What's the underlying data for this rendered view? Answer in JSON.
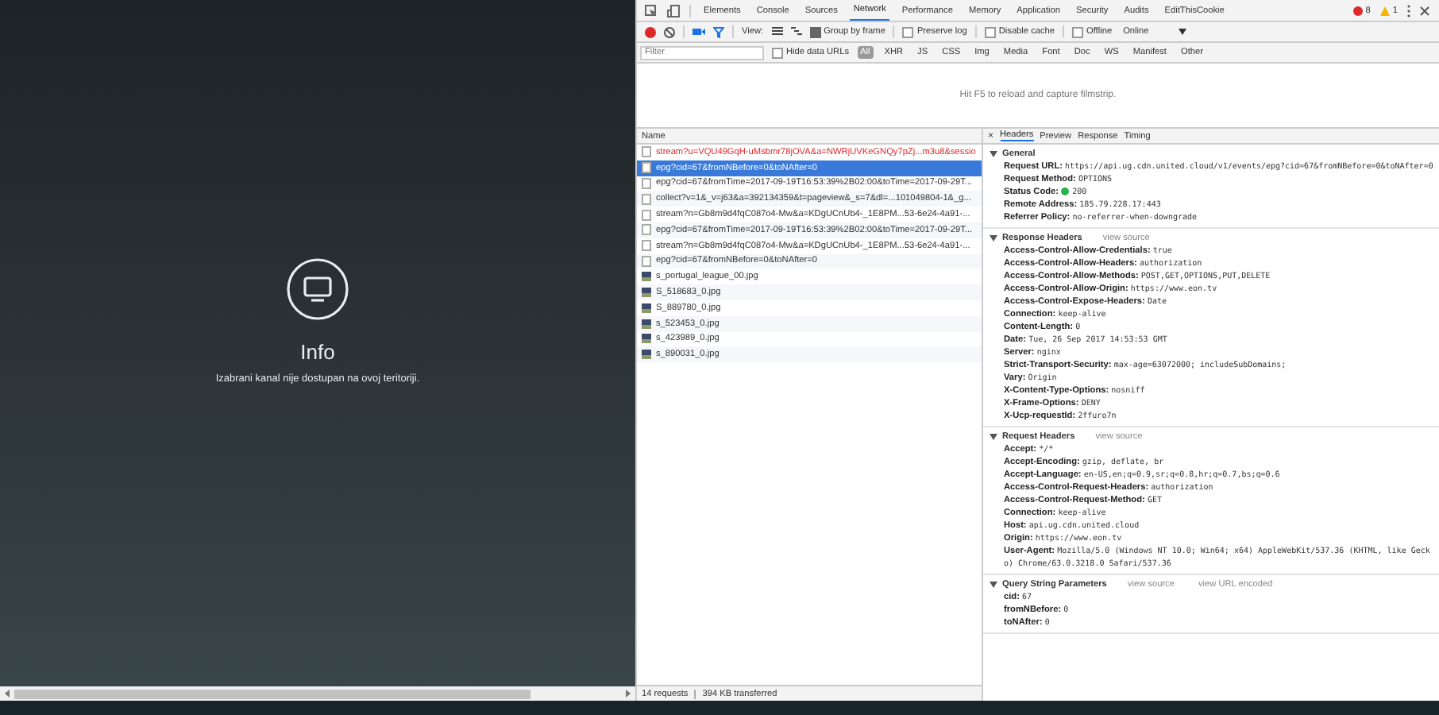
{
  "page": {
    "title": "Info",
    "message": "Izabrani kanal nije dostupan na ovoj teritoriji."
  },
  "devtools": {
    "tabs": [
      {
        "label": "Elements",
        "selected": false
      },
      {
        "label": "Console",
        "selected": false
      },
      {
        "label": "Sources",
        "selected": false
      },
      {
        "label": "Network",
        "selected": true
      },
      {
        "label": "Performance",
        "selected": false
      },
      {
        "label": "Memory",
        "selected": false
      },
      {
        "label": "Application",
        "selected": false
      },
      {
        "label": "Security",
        "selected": false
      },
      {
        "label": "Audits",
        "selected": false
      },
      {
        "label": "EditThisCookie",
        "selected": false
      }
    ],
    "errors": "8",
    "warnings": "1",
    "toolbar": {
      "view_label": "View:",
      "options": [
        {
          "label": "Group by frame",
          "checked": true
        },
        {
          "label": "Preserve log",
          "checked": false
        },
        {
          "label": "Disable cache",
          "checked": false
        },
        {
          "label": "Offline",
          "checked": false
        }
      ],
      "throttling": "Online"
    },
    "filter": {
      "placeholder": "Filter",
      "hide_data_urls": {
        "label": "Hide data URLs",
        "checked": false
      },
      "types": [
        {
          "label": "All",
          "selected": true
        },
        {
          "label": "XHR",
          "selected": false
        },
        {
          "label": "JS",
          "selected": false
        },
        {
          "label": "CSS",
          "selected": false
        },
        {
          "label": "Img",
          "selected": false
        },
        {
          "label": "Media",
          "selected": false
        },
        {
          "label": "Font",
          "selected": false
        },
        {
          "label": "Doc",
          "selected": false
        },
        {
          "label": "WS",
          "selected": false
        },
        {
          "label": "Manifest",
          "selected": false
        },
        {
          "label": "Other",
          "selected": false
        }
      ]
    },
    "filmstrip_hint": "Hit F5 to reload and capture filmstrip.",
    "requests": {
      "column": "Name",
      "rows": [
        {
          "name": "stream?u=VQU49GqH-uMsbmr78jOVA&a=NWRjUVKeGNQy7pZj...m3u8&sessio",
          "kind": "doc",
          "failed": true,
          "selected": false
        },
        {
          "name": "epg?cid=67&fromNBefore=0&toNAfter=0",
          "kind": "doc",
          "failed": false,
          "selected": true
        },
        {
          "name": "epg?cid=67&fromTime=2017-09-19T16:53:39%2B02:00&toTime=2017-09-29T...",
          "kind": "doc",
          "failed": false,
          "selected": false
        },
        {
          "name": "collect?v=1&_v=j63&a=392134359&t=pageview&_s=7&dl=...101049804-1&_g...",
          "kind": "doc",
          "failed": false,
          "selected": false
        },
        {
          "name": "stream?n=Gb8m9d4fqC087o4-Mw&a=KDgUCnUb4-_1E8PM...53-6e24-4a91-...",
          "kind": "doc",
          "failed": false,
          "selected": false
        },
        {
          "name": "epg?cid=67&fromTime=2017-09-19T16:53:39%2B02:00&toTime=2017-09-29T...",
          "kind": "doc",
          "failed": false,
          "selected": false
        },
        {
          "name": "stream?n=Gb8m9d4fqC087o4-Mw&a=KDgUCnUb4-_1E8PM...53-6e24-4a91-...",
          "kind": "doc",
          "failed": false,
          "selected": false
        },
        {
          "name": "epg?cid=67&fromNBefore=0&toNAfter=0",
          "kind": "doc",
          "failed": false,
          "selected": false
        },
        {
          "name": "s_portugal_league_00.jpg",
          "kind": "image",
          "failed": false,
          "selected": false
        },
        {
          "name": "S_518683_0.jpg",
          "kind": "image",
          "failed": false,
          "selected": false
        },
        {
          "name": "S_889780_0.jpg",
          "kind": "image",
          "failed": false,
          "selected": false
        },
        {
          "name": "s_523453_0.jpg",
          "kind": "image",
          "failed": false,
          "selected": false
        },
        {
          "name": "s_423989_0.jpg",
          "kind": "image",
          "failed": false,
          "selected": false
        },
        {
          "name": "s_890031_0.jpg",
          "kind": "image",
          "failed": false,
          "selected": false
        }
      ],
      "status": "14 requests",
      "transferred": "394 KB transferred"
    },
    "details": {
      "close": "×",
      "tabs": [
        {
          "label": "Headers",
          "selected": true
        },
        {
          "label": "Preview",
          "selected": false
        },
        {
          "label": "Response",
          "selected": false
        },
        {
          "label": "Timing",
          "selected": false
        }
      ],
      "sections": [
        {
          "title": "General",
          "expanded": true,
          "items": [
            {
              "key": "Request URL:",
              "value": "https://api.ug.cdn.united.cloud/v1/events/epg?cid=67&fromNBefore=0&toNAfter=0",
              "status_dot": false
            },
            {
              "key": "Request Method:",
              "value": "OPTIONS",
              "status_dot": false
            },
            {
              "key": "Status Code:",
              "value": "200",
              "status_dot": true
            },
            {
              "key": "Remote Address:",
              "value": "185.79.228.17:443",
              "status_dot": false
            },
            {
              "key": "Referrer Policy:",
              "value": "no-referrer-when-downgrade",
              "status_dot": false
            }
          ]
        },
        {
          "title": "Response Headers",
          "expanded": true,
          "links": [
            "view source"
          ],
          "items": [
            {
              "key": "Access-Control-Allow-Credentials:",
              "value": "true",
              "status_dot": false
            },
            {
              "key": "Access-Control-Allow-Headers:",
              "value": "authorization",
              "status_dot": false
            },
            {
              "key": "Access-Control-Allow-Methods:",
              "value": "POST,GET,OPTIONS,PUT,DELETE",
              "status_dot": false
            },
            {
              "key": "Access-Control-Allow-Origin:",
              "value": "https://www.eon.tv",
              "status_dot": false
            },
            {
              "key": "Access-Control-Expose-Headers:",
              "value": "Date",
              "status_dot": false
            },
            {
              "key": "Connection:",
              "value": "keep-alive",
              "status_dot": false
            },
            {
              "key": "Content-Length:",
              "value": "0",
              "status_dot": false
            },
            {
              "key": "Date:",
              "value": "Tue, 26 Sep 2017 14:53:53 GMT",
              "status_dot": false
            },
            {
              "key": "Server:",
              "value": "nginx",
              "status_dot": false
            },
            {
              "key": "Strict-Transport-Security:",
              "value": "max-age=63072000; includeSubDomains;",
              "status_dot": false
            },
            {
              "key": "Vary:",
              "value": "Origin",
              "status_dot": false
            },
            {
              "key": "X-Content-Type-Options:",
              "value": "nosniff",
              "status_dot": false
            },
            {
              "key": "X-Frame-Options:",
              "value": "DENY",
              "status_dot": false
            },
            {
              "key": "X-Ucp-requestId:",
              "value": "2ffuro7n",
              "status_dot": false
            }
          ]
        },
        {
          "title": "Request Headers",
          "expanded": true,
          "links": [
            "view source"
          ],
          "items": [
            {
              "key": "Accept:",
              "value": "*/*",
              "status_dot": false
            },
            {
              "key": "Accept-Encoding:",
              "value": "gzip, deflate, br",
              "status_dot": false
            },
            {
              "key": "Accept-Language:",
              "value": "en-US,en;q=0.9,sr;q=0.8,hr;q=0.7,bs;q=0.6",
              "status_dot": false
            },
            {
              "key": "Access-Control-Request-Headers:",
              "value": "authorization",
              "status_dot": false
            },
            {
              "key": "Access-Control-Request-Method:",
              "value": "GET",
              "status_dot": false
            },
            {
              "key": "Connection:",
              "value": "keep-alive",
              "status_dot": false
            },
            {
              "key": "Host:",
              "value": "api.ug.cdn.united.cloud",
              "status_dot": false
            },
            {
              "key": "Origin:",
              "value": "https://www.eon.tv",
              "status_dot": false
            },
            {
              "key": "User-Agent:",
              "value": "Mozilla/5.0 (Windows NT 10.0; Win64; x64) AppleWebKit/537.36 (KHTML, like Gecko) Chrome/63.0.3218.0 Safari/537.36",
              "status_dot": false
            }
          ]
        },
        {
          "title": "Query String Parameters",
          "expanded": true,
          "links": [
            "view source",
            "view URL encoded"
          ],
          "items": [
            {
              "key": "cid:",
              "value": "67",
              "status_dot": false
            },
            {
              "key": "fromNBefore:",
              "value": "0",
              "status_dot": false
            },
            {
              "key": "toNAfter:",
              "value": "0",
              "status_dot": false
            }
          ]
        }
      ]
    }
  }
}
